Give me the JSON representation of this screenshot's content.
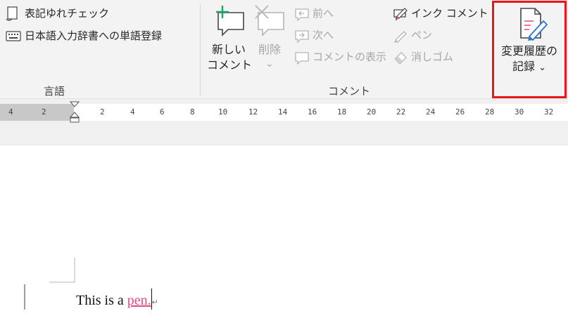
{
  "ribbon": {
    "language_group": {
      "translate_label": "表記ゆれチェック",
      "ime_dictionary_label": "日本語入力辞書への単語登録",
      "group_label": "言語"
    },
    "comment_group": {
      "new_comment_label_line1": "新しい",
      "new_comment_label_line2": "コメント",
      "delete_label": "削除",
      "previous_label": "前へ",
      "next_label": "次へ",
      "show_comments_label": "コメントの表示",
      "ink_comment_label": "インク コメント",
      "pen_label": "ペン",
      "eraser_label": "消しゴム",
      "group_label": "コメント"
    },
    "tracking_group": {
      "track_changes_line1": "変更履歴の",
      "track_changes_line2": "記録",
      "dropdown_glyph": "⌄"
    },
    "colors": {
      "highlight": "#e8161d",
      "accent_green": "#21a366",
      "accent_pink": "#e04a8a"
    }
  },
  "ruler": {
    "ticks": [
      "4",
      "2",
      "2",
      "4",
      "6",
      "8",
      "10",
      "12",
      "14",
      "16",
      "18",
      "20",
      "22",
      "24",
      "26",
      "28",
      "30",
      "32"
    ]
  },
  "document": {
    "text_plain": "This is a ",
    "text_inserted": "pen.",
    "paragraph_mark": "↵"
  }
}
